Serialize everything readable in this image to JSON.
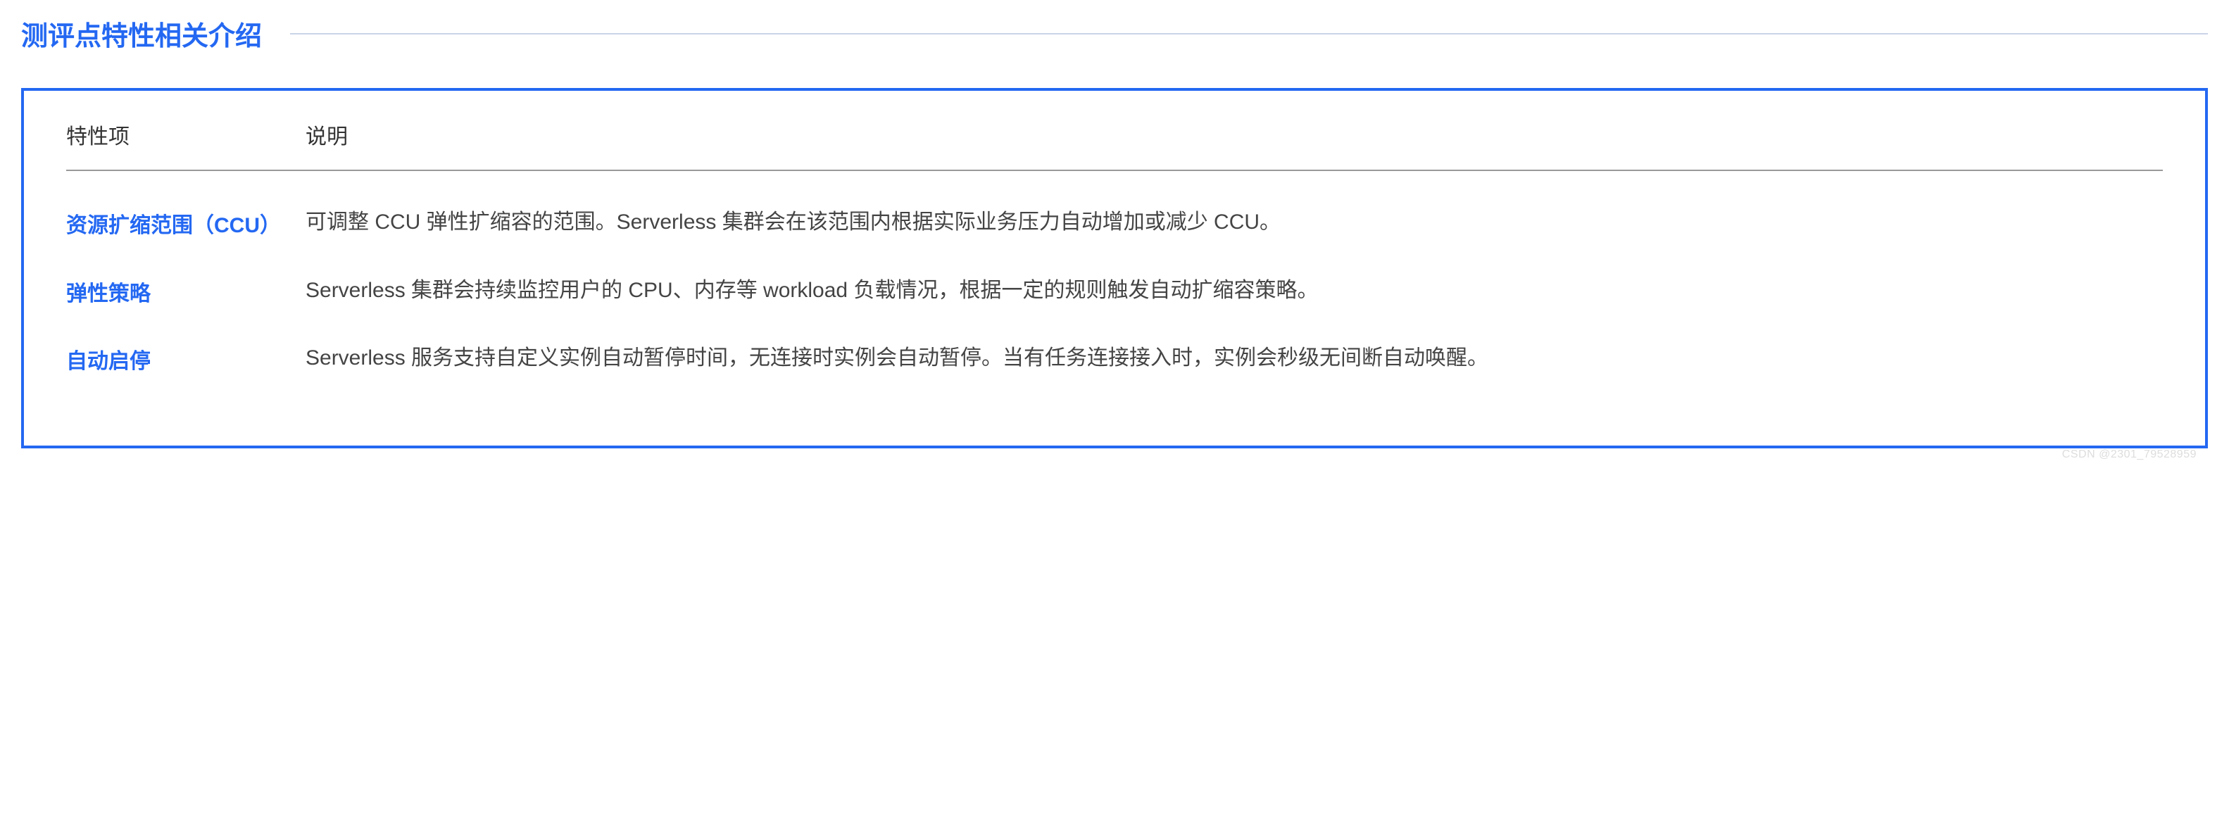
{
  "section": {
    "title": "测评点特性相关介绍"
  },
  "table": {
    "headers": {
      "feature": "特性项",
      "description": "说明"
    },
    "rows": [
      {
        "feature": "资源扩缩范围（CCU）",
        "description": "可调整 CCU 弹性扩缩容的范围。Serverless 集群会在该范围内根据实际业务压力自动增加或减少 CCU。"
      },
      {
        "feature": "弹性策略",
        "description": "Serverless 集群会持续监控用户的 CPU、内存等 workload 负载情况，根据一定的规则触发自动扩缩容策略。"
      },
      {
        "feature": "自动启停",
        "description": "Serverless 服务支持自定义实例自动暂停时间，无连接时实例会自动暂停。当有任务连接接入时，实例会秒级无间断自动唤醒。"
      }
    ]
  },
  "watermark": "CSDN @2301_79528959"
}
